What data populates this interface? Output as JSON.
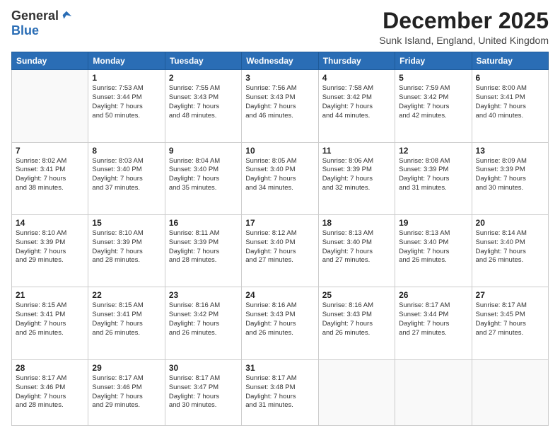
{
  "logo": {
    "general": "General",
    "blue": "Blue"
  },
  "title": "December 2025",
  "subtitle": "Sunk Island, England, United Kingdom",
  "days_of_week": [
    "Sunday",
    "Monday",
    "Tuesday",
    "Wednesday",
    "Thursday",
    "Friday",
    "Saturday"
  ],
  "weeks": [
    [
      {
        "day": "",
        "content": ""
      },
      {
        "day": "1",
        "content": "Sunrise: 7:53 AM\nSunset: 3:44 PM\nDaylight: 7 hours\nand 50 minutes."
      },
      {
        "day": "2",
        "content": "Sunrise: 7:55 AM\nSunset: 3:43 PM\nDaylight: 7 hours\nand 48 minutes."
      },
      {
        "day": "3",
        "content": "Sunrise: 7:56 AM\nSunset: 3:43 PM\nDaylight: 7 hours\nand 46 minutes."
      },
      {
        "day": "4",
        "content": "Sunrise: 7:58 AM\nSunset: 3:42 PM\nDaylight: 7 hours\nand 44 minutes."
      },
      {
        "day": "5",
        "content": "Sunrise: 7:59 AM\nSunset: 3:42 PM\nDaylight: 7 hours\nand 42 minutes."
      },
      {
        "day": "6",
        "content": "Sunrise: 8:00 AM\nSunset: 3:41 PM\nDaylight: 7 hours\nand 40 minutes."
      }
    ],
    [
      {
        "day": "7",
        "content": "Sunrise: 8:02 AM\nSunset: 3:41 PM\nDaylight: 7 hours\nand 38 minutes."
      },
      {
        "day": "8",
        "content": "Sunrise: 8:03 AM\nSunset: 3:40 PM\nDaylight: 7 hours\nand 37 minutes."
      },
      {
        "day": "9",
        "content": "Sunrise: 8:04 AM\nSunset: 3:40 PM\nDaylight: 7 hours\nand 35 minutes."
      },
      {
        "day": "10",
        "content": "Sunrise: 8:05 AM\nSunset: 3:40 PM\nDaylight: 7 hours\nand 34 minutes."
      },
      {
        "day": "11",
        "content": "Sunrise: 8:06 AM\nSunset: 3:39 PM\nDaylight: 7 hours\nand 32 minutes."
      },
      {
        "day": "12",
        "content": "Sunrise: 8:08 AM\nSunset: 3:39 PM\nDaylight: 7 hours\nand 31 minutes."
      },
      {
        "day": "13",
        "content": "Sunrise: 8:09 AM\nSunset: 3:39 PM\nDaylight: 7 hours\nand 30 minutes."
      }
    ],
    [
      {
        "day": "14",
        "content": "Sunrise: 8:10 AM\nSunset: 3:39 PM\nDaylight: 7 hours\nand 29 minutes."
      },
      {
        "day": "15",
        "content": "Sunrise: 8:10 AM\nSunset: 3:39 PM\nDaylight: 7 hours\nand 28 minutes."
      },
      {
        "day": "16",
        "content": "Sunrise: 8:11 AM\nSunset: 3:39 PM\nDaylight: 7 hours\nand 28 minutes."
      },
      {
        "day": "17",
        "content": "Sunrise: 8:12 AM\nSunset: 3:40 PM\nDaylight: 7 hours\nand 27 minutes."
      },
      {
        "day": "18",
        "content": "Sunrise: 8:13 AM\nSunset: 3:40 PM\nDaylight: 7 hours\nand 27 minutes."
      },
      {
        "day": "19",
        "content": "Sunrise: 8:13 AM\nSunset: 3:40 PM\nDaylight: 7 hours\nand 26 minutes."
      },
      {
        "day": "20",
        "content": "Sunrise: 8:14 AM\nSunset: 3:40 PM\nDaylight: 7 hours\nand 26 minutes."
      }
    ],
    [
      {
        "day": "21",
        "content": "Sunrise: 8:15 AM\nSunset: 3:41 PM\nDaylight: 7 hours\nand 26 minutes."
      },
      {
        "day": "22",
        "content": "Sunrise: 8:15 AM\nSunset: 3:41 PM\nDaylight: 7 hours\nand 26 minutes."
      },
      {
        "day": "23",
        "content": "Sunrise: 8:16 AM\nSunset: 3:42 PM\nDaylight: 7 hours\nand 26 minutes."
      },
      {
        "day": "24",
        "content": "Sunrise: 8:16 AM\nSunset: 3:43 PM\nDaylight: 7 hours\nand 26 minutes."
      },
      {
        "day": "25",
        "content": "Sunrise: 8:16 AM\nSunset: 3:43 PM\nDaylight: 7 hours\nand 26 minutes."
      },
      {
        "day": "26",
        "content": "Sunrise: 8:17 AM\nSunset: 3:44 PM\nDaylight: 7 hours\nand 27 minutes."
      },
      {
        "day": "27",
        "content": "Sunrise: 8:17 AM\nSunset: 3:45 PM\nDaylight: 7 hours\nand 27 minutes."
      }
    ],
    [
      {
        "day": "28",
        "content": "Sunrise: 8:17 AM\nSunset: 3:46 PM\nDaylight: 7 hours\nand 28 minutes."
      },
      {
        "day": "29",
        "content": "Sunrise: 8:17 AM\nSunset: 3:46 PM\nDaylight: 7 hours\nand 29 minutes."
      },
      {
        "day": "30",
        "content": "Sunrise: 8:17 AM\nSunset: 3:47 PM\nDaylight: 7 hours\nand 30 minutes."
      },
      {
        "day": "31",
        "content": "Sunrise: 8:17 AM\nSunset: 3:48 PM\nDaylight: 7 hours\nand 31 minutes."
      },
      {
        "day": "",
        "content": ""
      },
      {
        "day": "",
        "content": ""
      },
      {
        "day": "",
        "content": ""
      }
    ]
  ]
}
